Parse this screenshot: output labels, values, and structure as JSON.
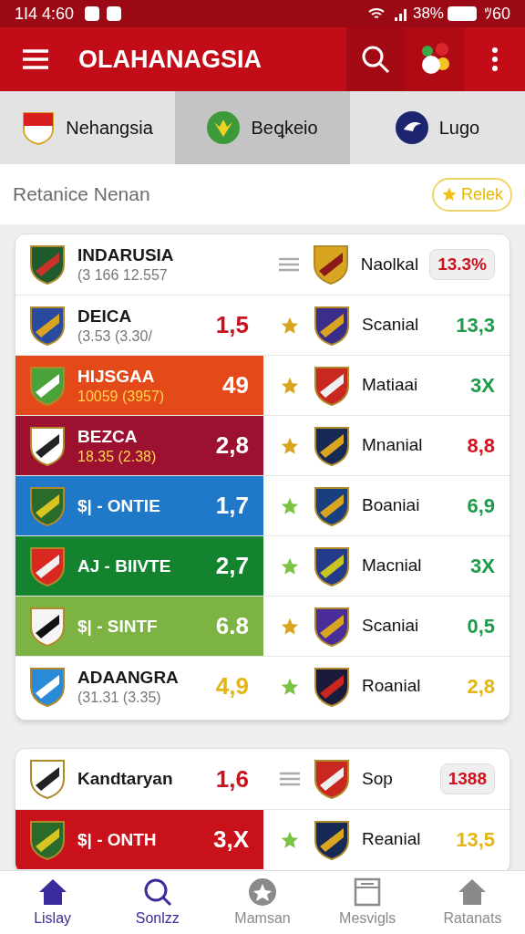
{
  "status_bar": {
    "time": "1I4 4:60",
    "battery": "38%",
    "extra": "ﾂ60"
  },
  "app_bar": {
    "title": "OLAHANAGSIA"
  },
  "tabs": [
    {
      "label": "Nehangsia",
      "selected": false
    },
    {
      "label": "Beꝗkeio",
      "selected": true
    },
    {
      "label": "Lugo",
      "selected": false
    }
  ],
  "section": {
    "title": "Retanice Nenan",
    "badge": "Relek"
  },
  "cards": [
    {
      "rows": [
        {
          "name": "INDARUSIA",
          "sub": "(3 166 12.557",
          "marker": {
            "kind": "lines"
          },
          "right_name": "Naolkal",
          "value": {
            "text": "13.3%",
            "color": "#d0121f",
            "kind": "badge"
          }
        },
        {
          "name": "DEICA",
          "sub": "(3.53  (3.30/",
          "score": {
            "text": "1,5",
            "color": "#c8121d"
          },
          "marker": {
            "kind": "star",
            "color": "#d9a521"
          },
          "right_name": "Scanial",
          "value": {
            "text": "13,3",
            "color": "#1e9a4a",
            "kind": "plain"
          }
        },
        {
          "name": "HIJSGAA",
          "sub": "10059  (3957)",
          "score": {
            "text": "49",
            "color": "#ffffff"
          },
          "band": {
            "color": "#e4491a"
          },
          "marker": {
            "kind": "star",
            "color": "#d9a521"
          },
          "right_name": "Matiaai",
          "value": {
            "text": "3X",
            "color": "#1e9a4a",
            "kind": "plain"
          }
        },
        {
          "name": "BEZCA",
          "sub": "18.35  (2.38)",
          "score": {
            "text": "2,8",
            "color": "#ffffff"
          },
          "band": {
            "color": "#9c1130"
          },
          "marker": {
            "kind": "star",
            "color": "#d9a521"
          },
          "right_name": "Mnanial",
          "value": {
            "text": "8,8",
            "color": "#d0121f",
            "kind": "plain"
          }
        },
        {
          "name": "$| - ONTIE",
          "score": {
            "text": "1,7",
            "color": "#ffffff"
          },
          "band": {
            "color": "#1f78c8"
          },
          "marker": {
            "kind": "star",
            "color": "#7cc243"
          },
          "right_name": "Boaniai",
          "value": {
            "text": "6,9",
            "color": "#1e9a4a",
            "kind": "plain"
          }
        },
        {
          "name": "AJ - BIIVTE",
          "score": {
            "text": "2,7",
            "color": "#ffffff"
          },
          "band": {
            "color": "#13832f"
          },
          "marker": {
            "kind": "star",
            "color": "#7cc243"
          },
          "right_name": "Macnial",
          "value": {
            "text": "3X",
            "color": "#1e9a4a",
            "kind": "plain"
          }
        },
        {
          "name": "$| - SINTF",
          "score": {
            "text": "6.8",
            "color": "#ffffff"
          },
          "band": {
            "color": "#7cb342"
          },
          "marker": {
            "kind": "star",
            "color": "#d9a521"
          },
          "right_name": "Scaniai",
          "value": {
            "text": "0,5",
            "color": "#1e9a4a",
            "kind": "plain"
          }
        },
        {
          "name": "ADAANGRA",
          "sub": "(31.31  (3.35)",
          "score": {
            "text": "4,9",
            "color": "#e2b615"
          },
          "marker": {
            "kind": "star",
            "color": "#7cc243"
          },
          "right_name": "Roanial",
          "value": {
            "text": "2,8",
            "color": "#e2b615",
            "kind": "plain"
          }
        }
      ]
    },
    {
      "rows": [
        {
          "name": "Kandtaryan",
          "score": {
            "text": "1,6",
            "color": "#c8121d"
          },
          "marker": {
            "kind": "lines"
          },
          "right_name": "Sop",
          "value": {
            "text": "1388",
            "color": "#d0121f",
            "kind": "badge"
          }
        },
        {
          "name": "$| - ONTH",
          "score": {
            "text": "3,X",
            "color": "#ffffff"
          },
          "band": {
            "color": "#c8111b"
          },
          "marker": {
            "kind": "star",
            "color": "#7cc243"
          },
          "right_name": "Reanial",
          "value": {
            "text": "13,5",
            "color": "#e2b615",
            "kind": "plain"
          }
        }
      ]
    }
  ],
  "nav": [
    {
      "label": "Lislay",
      "active": true
    },
    {
      "label": "Sonlzz",
      "active": true
    },
    {
      "label": "Mamsan",
      "active": false
    },
    {
      "label": "Mesvigls",
      "active": false
    },
    {
      "label": "Ratanats",
      "active": false
    }
  ]
}
